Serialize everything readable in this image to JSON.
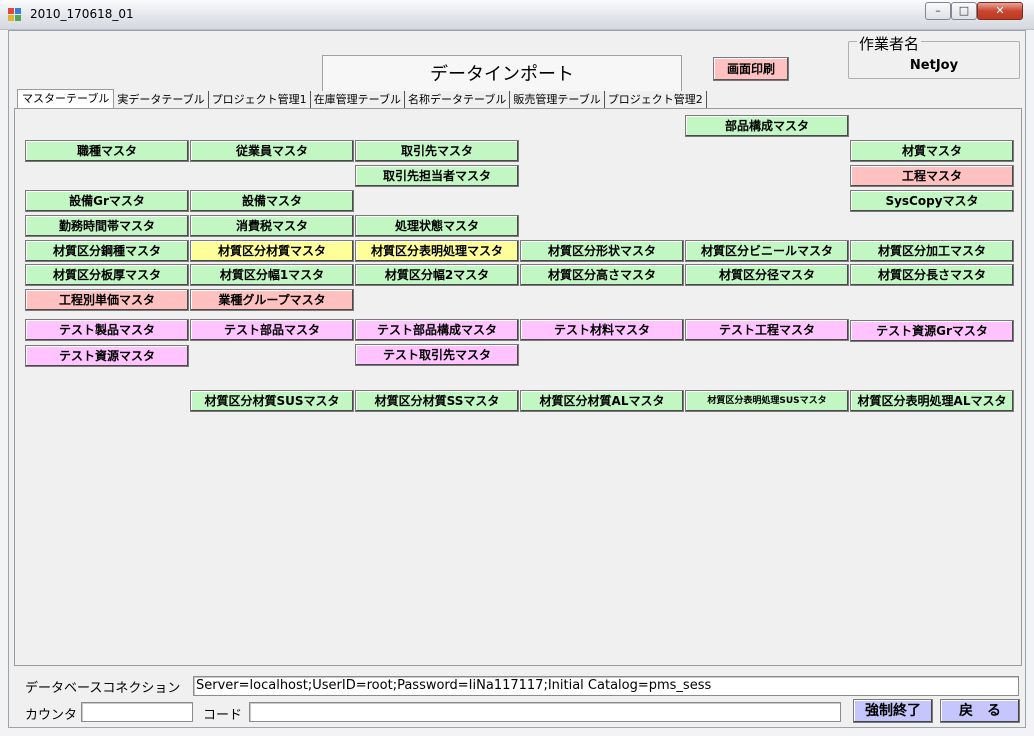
{
  "window": {
    "title": "2010_170618_01",
    "min_glyph": "–",
    "max_glyph": "□",
    "close_glyph": "✕"
  },
  "header": {
    "title": "データインポート",
    "print_label": "画面印刷",
    "worker_legend": "作業者名",
    "worker_name": "NetJoy"
  },
  "tabs": [
    {
      "label": "マスターテーブル"
    },
    {
      "label": "実データテーブル"
    },
    {
      "label": "プロジェクト管理1"
    },
    {
      "label": "在庫管理テーブル"
    },
    {
      "label": "名称データテーブル"
    },
    {
      "label": "販売管理テーブル"
    },
    {
      "label": "プロジェクト管理2"
    }
  ],
  "buttons": [
    {
      "label": "部品構成マスタ",
      "color": "#c2f6c2"
    },
    {
      "label": "職種マスタ",
      "color": "#c2f6c2"
    },
    {
      "label": "従業員マスタ",
      "color": "#c2f6c2"
    },
    {
      "label": "取引先マスタ",
      "color": "#c2f6c2"
    },
    {
      "label": "材質マスタ",
      "color": "#c2f6c2"
    },
    {
      "label": "取引先担当者マスタ",
      "color": "#c2f6c2"
    },
    {
      "label": "工程マスタ",
      "color": "#ffc0c0"
    },
    {
      "label": "設備Grマスタ",
      "color": "#c2f6c2"
    },
    {
      "label": "設備マスタ",
      "color": "#c2f6c2"
    },
    {
      "label": "SysCopyマスタ",
      "color": "#c2f6c2"
    },
    {
      "label": "勤務時間帯マスタ",
      "color": "#c2f6c2"
    },
    {
      "label": "消費税マスタ",
      "color": "#c2f6c2"
    },
    {
      "label": "処理状態マスタ",
      "color": "#c2f6c2"
    },
    {
      "label": "材質区分鋼種マスタ",
      "color": "#c2f6c2"
    },
    {
      "label": "材質区分材質マスタ",
      "color": "#ffff99"
    },
    {
      "label": "材質区分表明処理マスタ",
      "color": "#ffff99"
    },
    {
      "label": "材質区分形状マスタ",
      "color": "#c2f6c2"
    },
    {
      "label": "材質区分ビニールマスタ",
      "color": "#c2f6c2"
    },
    {
      "label": "材質区分加工マスタ",
      "color": "#c2f6c2"
    },
    {
      "label": "材質区分板厚マスタ",
      "color": "#c2f6c2"
    },
    {
      "label": "材質区分幅1マスタ",
      "color": "#c2f6c2"
    },
    {
      "label": "材質区分幅2マスタ",
      "color": "#c2f6c2"
    },
    {
      "label": "材質区分高さマスタ",
      "color": "#c2f6c2"
    },
    {
      "label": "材質区分径マスタ",
      "color": "#c2f6c2"
    },
    {
      "label": "材質区分長さマスタ",
      "color": "#c2f6c2"
    },
    {
      "label": "工程別単価マスタ",
      "color": "#ffc0c0"
    },
    {
      "label": "業種グループマスタ",
      "color": "#ffc0c0"
    },
    {
      "label": "テスト製品マスタ",
      "color": "#ffc4ff"
    },
    {
      "label": "テスト部品マスタ",
      "color": "#ffc4ff"
    },
    {
      "label": "テスト部品構成マスタ",
      "color": "#ffc4ff"
    },
    {
      "label": "テスト材料マスタ",
      "color": "#ffc4ff"
    },
    {
      "label": "テスト工程マスタ",
      "color": "#ffc4ff"
    },
    {
      "label": "テスト資源Grマスタ",
      "color": "#ffc4ff"
    },
    {
      "label": "テスト資源マスタ",
      "color": "#ffc4ff"
    },
    {
      "label": "テスト取引先マスタ",
      "color": "#ffc4ff"
    },
    {
      "label": "材質区分材質SUSマスタ",
      "color": "#c2f6c2"
    },
    {
      "label": "材質区分材質SSマスタ",
      "color": "#c2f6c2"
    },
    {
      "label": "材質区分材質ALマスタ",
      "color": "#c2f6c2"
    },
    {
      "label": "材質区分表明処理SUSマスタ",
      "color": "#c2f6c2"
    },
    {
      "label": "材質区分表明処理ALマスタ",
      "color": "#c2f6c2"
    }
  ],
  "footer": {
    "db_label": "データベースコネクション",
    "db_value": "Server=localhost;UserID=root;Password=IiNa117117;Initial Catalog=pms_sess",
    "counter_label": "カウンタ",
    "counter_value": "",
    "code_label": "コード",
    "code_value": "",
    "force_quit_label": "強制終了",
    "back_label": "戻　る"
  }
}
